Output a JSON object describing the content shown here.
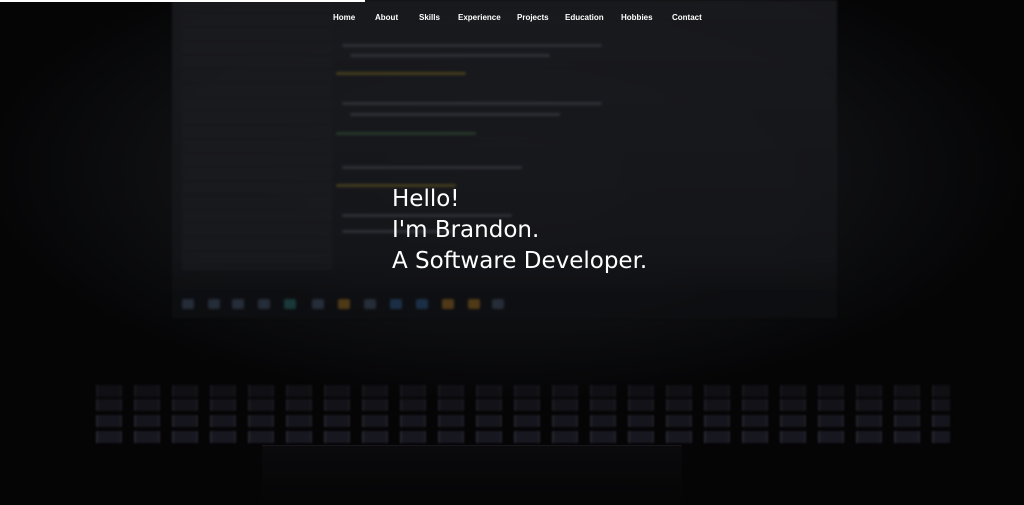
{
  "nav": {
    "items": [
      "Home",
      "About",
      "Skills",
      "Experience",
      "Projects",
      "Education",
      "Hobbies",
      "Contact"
    ]
  },
  "hero": {
    "line1": "Hello!",
    "line2": "I'm Brandon.",
    "line3": "A Software Developer."
  },
  "colors": {
    "background": "#000000",
    "text": "#ffffff"
  }
}
